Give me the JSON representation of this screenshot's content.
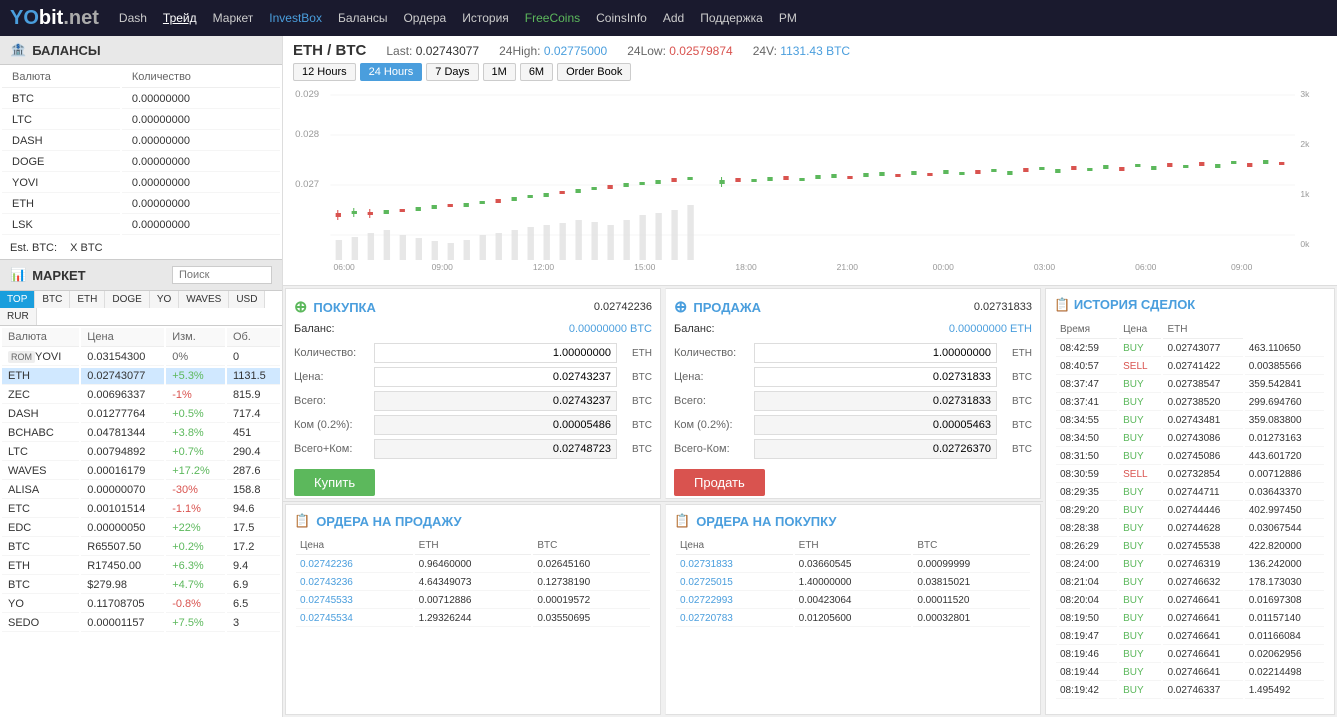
{
  "header": {
    "logo_yo": "YO",
    "logo_bit": "bit",
    "logo_net": ".net",
    "nav": [
      {
        "label": "Dash",
        "class": ""
      },
      {
        "label": "Трейд",
        "class": "active"
      },
      {
        "label": "Маркет",
        "class": ""
      },
      {
        "label": "InvestBox",
        "class": "blue"
      },
      {
        "label": "Балансы",
        "class": ""
      },
      {
        "label": "Ордера",
        "class": ""
      },
      {
        "label": "История",
        "class": ""
      },
      {
        "label": "FreeCoins",
        "class": "green"
      },
      {
        "label": "CoinsInfo",
        "class": ""
      },
      {
        "label": "Add",
        "class": ""
      },
      {
        "label": "Поддержка",
        "class": ""
      },
      {
        "label": "PM",
        "class": ""
      }
    ]
  },
  "balances": {
    "title": "БАЛАНСЫ",
    "col1": "Валюта",
    "col2": "Количество",
    "rows": [
      {
        "currency": "BTC",
        "amount": "0.00000000"
      },
      {
        "currency": "LTC",
        "amount": "0.00000000"
      },
      {
        "currency": "DASH",
        "amount": "0.00000000"
      },
      {
        "currency": "DOGE",
        "amount": "0.00000000"
      },
      {
        "currency": "YOVI",
        "amount": "0.00000000"
      },
      {
        "currency": "ETH",
        "amount": "0.00000000"
      },
      {
        "currency": "LSK",
        "amount": "0.00000000"
      }
    ],
    "est_label": "Est. BTC:",
    "est_value": "X BTC"
  },
  "market": {
    "title": "МАРКЕТ",
    "search_placeholder": "Поиск",
    "tabs": [
      "TOP",
      "BTC",
      "ETH",
      "DOGE",
      "YO",
      "WAVES",
      "USD",
      "RUR"
    ],
    "cols": [
      "Валюта",
      "Цена",
      "Изм.",
      "Об."
    ],
    "rows": [
      {
        "label": "ROM",
        "currency": "YOVI",
        "price": "0.03154300",
        "change": "0%",
        "vol": "0",
        "selected": false
      },
      {
        "label": "",
        "currency": "ETH",
        "price": "0.02743077",
        "change": "+5.3%",
        "vol": "1131.5",
        "selected": true
      },
      {
        "label": "",
        "currency": "ZEC",
        "price": "0.00696337",
        "change": "-1%",
        "vol": "815.9",
        "selected": false
      },
      {
        "label": "",
        "currency": "DASH",
        "price": "0.01277764",
        "change": "+0.5%",
        "vol": "717.4",
        "selected": false
      },
      {
        "label": "",
        "currency": "BCHABC",
        "price": "0.04781344",
        "change": "+3.8%",
        "vol": "451",
        "selected": false
      },
      {
        "label": "",
        "currency": "LTC",
        "price": "0.00794892",
        "change": "+0.7%",
        "vol": "290.4",
        "selected": false
      },
      {
        "label": "",
        "currency": "WAVES",
        "price": "0.00016179",
        "change": "+17.2%",
        "vol": "287.6",
        "selected": false
      },
      {
        "label": "",
        "currency": "ALISA",
        "price": "0.00000070",
        "change": "-30%",
        "vol": "158.8",
        "selected": false
      },
      {
        "label": "",
        "currency": "ETC",
        "price": "0.00101514",
        "change": "-1.1%",
        "vol": "94.6",
        "selected": false
      },
      {
        "label": "",
        "currency": "EDC",
        "price": "0.00000050",
        "change": "+22%",
        "vol": "17.5",
        "selected": false
      },
      {
        "label": "",
        "currency": "BTC",
        "price": "R65507.50",
        "change": "+0.2%",
        "vol": "17.2",
        "selected": false
      },
      {
        "label": "",
        "currency": "ETH",
        "price": "R17450.00",
        "change": "+6.3%",
        "vol": "9.4",
        "selected": false
      },
      {
        "label": "",
        "currency": "BTC",
        "price": "$279.98",
        "change": "+4.7%",
        "vol": "6.9",
        "selected": false
      },
      {
        "label": "",
        "currency": "YO",
        "price": "0.11708705",
        "change": "-0.8%",
        "vol": "6.5",
        "selected": false
      },
      {
        "label": "",
        "currency": "SEDO",
        "price": "0.00001157",
        "change": "+7.5%",
        "vol": "3",
        "selected": false
      }
    ]
  },
  "chart": {
    "pair": "ETH / BTC",
    "last_label": "Last:",
    "last_val": "0.02743077",
    "high_label": "24High:",
    "high_val": "0.02775000",
    "low_label": "24Low:",
    "low_val": "0.02579874",
    "vol_label": "24V:",
    "vol_val": "1131.43 BTC",
    "time_btns": [
      "12 Hours",
      "24 Hours",
      "7 Days",
      "1M",
      "6M",
      "Order Book"
    ],
    "active_btn": "24 Hours",
    "y_labels": [
      "0.029",
      "0.028",
      "0.027",
      ""
    ],
    "x_labels": [
      "06:00",
      "09:00",
      "12:00",
      "15:00",
      "18:00",
      "21:00",
      "00:00",
      "03:00",
      "06:00",
      "09:00"
    ],
    "vol_labels": [
      "3k",
      "2k",
      "1k",
      "0k"
    ]
  },
  "buy_panel": {
    "title": "ПОКУПКА",
    "price": "0.02742236",
    "balance_label": "Баланс:",
    "balance_val": "0.00000000 BTC",
    "qty_label": "Количество:",
    "qty_val": "1.00000000",
    "qty_unit": "ETH",
    "price_label": "Цена:",
    "price_val": "0.02743237",
    "price_unit": "BTC",
    "total_label": "Всего:",
    "total_val": "0.02743237",
    "total_unit": "BTC",
    "fee_label": "Ком (0.2%):",
    "fee_val": "0.00005486",
    "fee_unit": "BTC",
    "grand_label": "Всего+Ком:",
    "grand_val": "0.02748723",
    "grand_unit": "BTC",
    "btn_label": "Купить"
  },
  "sell_panel": {
    "title": "ПРОДАЖА",
    "price": "0.02731833",
    "balance_label": "Баланс:",
    "balance_val": "0.00000000 ETH",
    "qty_label": "Количество:",
    "qty_val": "1.00000000",
    "qty_unit": "ETH",
    "price_label": "Цена:",
    "price_val": "0.02731833",
    "price_unit": "BTC",
    "total_label": "Всего:",
    "total_val": "0.02731833",
    "total_unit": "BTC",
    "fee_label": "Ком (0.2%):",
    "fee_val": "0.00005463",
    "fee_unit": "BTC",
    "grand_label": "Всего-Ком:",
    "grand_val": "0.02726370",
    "grand_unit": "BTC",
    "btn_label": "Продать"
  },
  "sell_orders": {
    "title": "ОРДЕРА НА ПРОДАЖУ",
    "cols": [
      "Цена",
      "ETH",
      "BTC"
    ],
    "rows": [
      {
        "price": "0.02742236",
        "eth": "0.96460000",
        "btc": "0.02645160"
      },
      {
        "price": "0.02743236",
        "eth": "4.64349073",
        "btc": "0.12738190"
      },
      {
        "price": "0.02745533",
        "eth": "0.00712886",
        "btc": "0.00019572"
      },
      {
        "price": "0.02745534",
        "eth": "1.29326244",
        "btc": "0.03550695"
      }
    ]
  },
  "buy_orders": {
    "title": "ОРДЕРА НА ПОКУПКУ",
    "cols": [
      "Цена",
      "ETH",
      "BTC"
    ],
    "rows": [
      {
        "price": "0.02731833",
        "eth": "0.03660545",
        "btc": "0.00099999"
      },
      {
        "price": "0.02725015",
        "eth": "1.40000000",
        "btc": "0.03815021"
      },
      {
        "price": "0.02722993",
        "eth": "0.00423064",
        "btc": "0.00011520"
      },
      {
        "price": "0.02720783",
        "eth": "0.01205600",
        "btc": "0.00032801"
      }
    ]
  },
  "history": {
    "title": "ИСТОРИЯ СДЕЛОК",
    "col_time": "Время",
    "col_type": "Цена",
    "col_price": "ETH",
    "rows": [
      {
        "time": "08:42:59",
        "type": "BUY",
        "price": "0.02743077",
        "eth": "463.110650"
      },
      {
        "time": "08:40:57",
        "type": "SELL",
        "price": "0.02741422",
        "eth": "0.00385566"
      },
      {
        "time": "08:37:47",
        "type": "BUY",
        "price": "0.02738547",
        "eth": "359.542841"
      },
      {
        "time": "08:37:41",
        "type": "BUY",
        "price": "0.02738520",
        "eth": "299.694760"
      },
      {
        "time": "08:34:55",
        "type": "BUY",
        "price": "0.02743481",
        "eth": "359.083800"
      },
      {
        "time": "08:34:50",
        "type": "BUY",
        "price": "0.02743086",
        "eth": "0.01273163"
      },
      {
        "time": "08:31:50",
        "type": "BUY",
        "price": "0.02745086",
        "eth": "443.601720"
      },
      {
        "time": "08:30:59",
        "type": "SELL",
        "price": "0.02732854",
        "eth": "0.00712886"
      },
      {
        "time": "08:29:35",
        "type": "BUY",
        "price": "0.02744711",
        "eth": "0.03643370"
      },
      {
        "time": "08:29:20",
        "type": "BUY",
        "price": "0.02744446",
        "eth": "402.997450"
      },
      {
        "time": "08:28:38",
        "type": "BUY",
        "price": "0.02744628",
        "eth": "0.03067544"
      },
      {
        "time": "08:26:29",
        "type": "BUY",
        "price": "0.02745538",
        "eth": "422.820000"
      },
      {
        "time": "08:24:00",
        "type": "BUY",
        "price": "0.02746319",
        "eth": "136.242000"
      },
      {
        "time": "08:21:04",
        "type": "BUY",
        "price": "0.02746632",
        "eth": "178.173030"
      },
      {
        "time": "08:20:04",
        "type": "BUY",
        "price": "0.02746641",
        "eth": "0.01697308"
      },
      {
        "time": "08:19:50",
        "type": "BUY",
        "price": "0.02746641",
        "eth": "0.01157140"
      },
      {
        "time": "08:19:47",
        "type": "BUY",
        "price": "0.02746641",
        "eth": "0.01166084"
      },
      {
        "time": "08:19:46",
        "type": "BUY",
        "price": "0.02746641",
        "eth": "0.02062956"
      },
      {
        "time": "08:19:44",
        "type": "BUY",
        "price": "0.02746641",
        "eth": "0.02214498"
      },
      {
        "time": "08:19:42",
        "type": "BUY",
        "price": "0.02746337",
        "eth": "1.495492"
      }
    ]
  }
}
